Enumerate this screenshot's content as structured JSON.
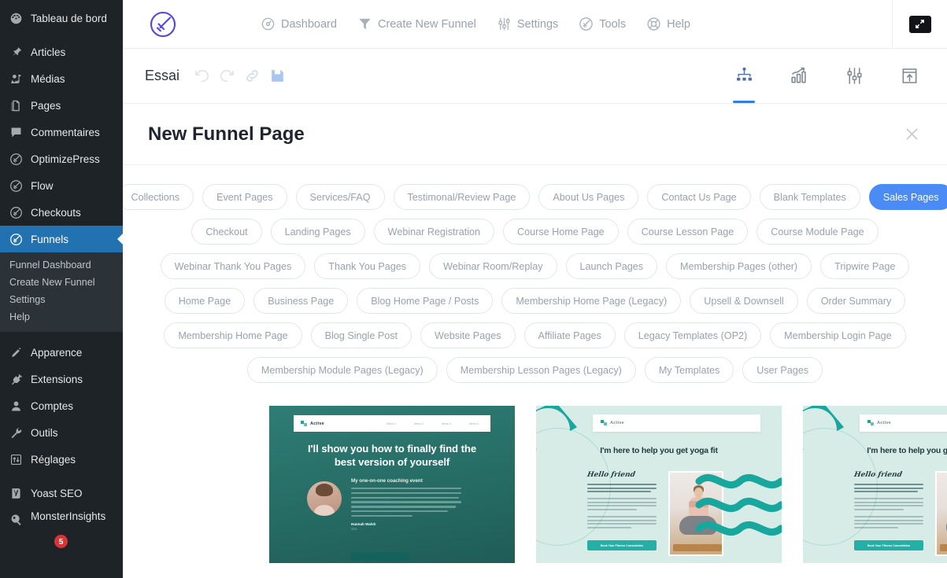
{
  "sidebar": {
    "items": [
      {
        "label": "Tableau de bord",
        "icon": "dashboard-icon"
      },
      {
        "label": "Articles",
        "icon": "pin-icon"
      },
      {
        "label": "Médias",
        "icon": "media-icon"
      },
      {
        "label": "Pages",
        "icon": "pages-icon"
      },
      {
        "label": "Commentaires",
        "icon": "comments-icon"
      },
      {
        "label": "OptimizePress",
        "icon": "rocket-icon"
      },
      {
        "label": "Flow",
        "icon": "rocket-icon"
      },
      {
        "label": "Checkouts",
        "icon": "rocket-icon"
      },
      {
        "label": "Funnels",
        "icon": "rocket-icon",
        "active": true
      }
    ],
    "submenu": [
      {
        "label": "Funnel Dashboard"
      },
      {
        "label": "Create New Funnel"
      },
      {
        "label": "Settings"
      },
      {
        "label": "Help"
      }
    ],
    "items2": [
      {
        "label": "Apparence",
        "icon": "brush-icon"
      },
      {
        "label": "Extensions",
        "icon": "plug-icon"
      },
      {
        "label": "Comptes",
        "icon": "user-icon"
      },
      {
        "label": "Outils",
        "icon": "wrench-icon"
      },
      {
        "label": "Réglages",
        "icon": "settings-icon"
      }
    ],
    "items3": [
      {
        "label": "Yoast SEO",
        "icon": "yoast-icon"
      },
      {
        "label": "MonsterInsights",
        "icon": "monsterinsights-icon",
        "badge": "5"
      }
    ]
  },
  "topnav": {
    "logo": "optimizepress-rocket-logo",
    "links": [
      {
        "label": "Dashboard",
        "icon": "dashboard-circle-icon"
      },
      {
        "label": "Create New Funnel",
        "icon": "funnel-icon"
      },
      {
        "label": "Settings",
        "icon": "sliders-icon"
      },
      {
        "label": "Tools",
        "icon": "rocket-icon"
      },
      {
        "label": "Help",
        "icon": "lifebuoy-icon"
      }
    ],
    "fullscreen": "fullscreen-toggle"
  },
  "subbar": {
    "title": "Essai",
    "tools": [
      {
        "name": "undo-icon"
      },
      {
        "name": "redo-icon"
      },
      {
        "name": "link-icon"
      },
      {
        "name": "save-icon"
      }
    ],
    "right_tools": [
      {
        "name": "funnel-map-icon",
        "active": true
      },
      {
        "name": "stats-icon",
        "active": false
      },
      {
        "name": "settings-sliders-icon",
        "active": false
      },
      {
        "name": "export-icon",
        "active": false
      }
    ]
  },
  "panel": {
    "title": "New Funnel Page",
    "close_label": "×"
  },
  "filters": {
    "rows": [
      [
        {
          "label": "Collections"
        },
        {
          "label": "Event Pages"
        },
        {
          "label": "Services/FAQ"
        },
        {
          "label": "Testimonal/Review Page"
        },
        {
          "label": "About Us Pages"
        },
        {
          "label": "Contact Us Page"
        },
        {
          "label": "Blank Templates"
        },
        {
          "label": "Sales Pages",
          "active": true
        }
      ],
      [
        {
          "label": "Checkout"
        },
        {
          "label": "Landing Pages"
        },
        {
          "label": "Webinar Registration"
        },
        {
          "label": "Course Home Page"
        },
        {
          "label": "Course Lesson Page"
        },
        {
          "label": "Course Module Page"
        }
      ],
      [
        {
          "label": "Webinar Thank You Pages"
        },
        {
          "label": "Thank You Pages"
        },
        {
          "label": "Webinar Room/Replay"
        },
        {
          "label": "Launch Pages"
        },
        {
          "label": "Membership Pages (other)"
        },
        {
          "label": "Tripwire Page"
        }
      ],
      [
        {
          "label": "Home Page"
        },
        {
          "label": "Business Page"
        },
        {
          "label": "Blog Home Page / Posts"
        },
        {
          "label": "Membership Home Page (Legacy)"
        },
        {
          "label": "Upsell & Downsell"
        },
        {
          "label": "Order Summary"
        }
      ],
      [
        {
          "label": "Membership Home Page"
        },
        {
          "label": "Blog Single Post"
        },
        {
          "label": "Website Pages"
        },
        {
          "label": "Affiliate Pages"
        },
        {
          "label": "Legacy Templates (OP2)"
        },
        {
          "label": "Membership Login Page"
        }
      ],
      [
        {
          "label": "Membership Module Pages (Legacy)"
        },
        {
          "label": "Membership Lesson Pages (Legacy)"
        },
        {
          "label": "My Templates"
        },
        {
          "label": "User Pages"
        }
      ]
    ]
  },
  "templates": [
    {
      "type": "coaching",
      "brand": "Active",
      "menus": [
        "Menu 1",
        "Menu 2",
        "Menu 3",
        "Menu 4"
      ],
      "headline": "I'll show you how to finally find the best version of yourself",
      "subhead": "My one-on-one coaching event",
      "name": "Hannah Walsh",
      "role": "CEO"
    },
    {
      "type": "yoga",
      "brand": "Active",
      "headline": "I'm here to help you get yoga fit",
      "script": "Hello friend",
      "button": "Book Your Fitness Consultation"
    },
    {
      "type": "yoga",
      "brand": "Active",
      "headline": "I'm here to help you get yoga fit",
      "script": "Hello friend",
      "button": "Book Your Fitness Consultation"
    }
  ],
  "colors": {
    "accent_blue": "#4a8bf5",
    "sidebar_bg": "#1d2327",
    "sidebar_active": "#2271b1",
    "logo_purple": "#4f46e5",
    "teal_dark": "#2e7d75",
    "teal_bright": "#17a79c",
    "mint_bg": "#d7ebe7",
    "badge_red": "#d63638"
  }
}
